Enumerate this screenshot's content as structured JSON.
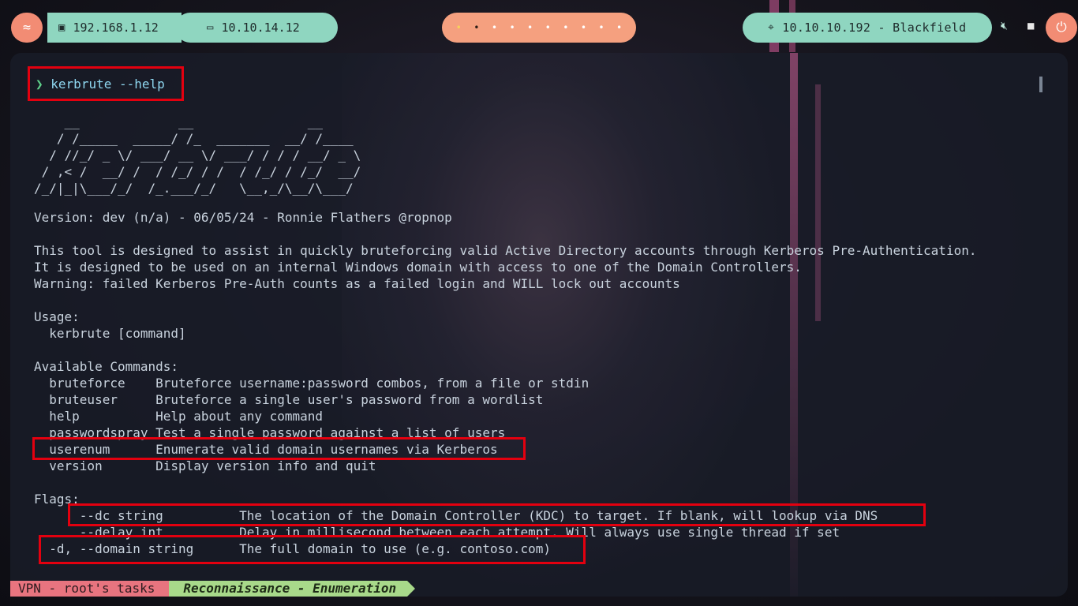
{
  "topbar": {
    "ip_local": "192.168.1.12",
    "ip_vpn": "10.10.14.12",
    "target": "10.10.10.192 - Blackfield",
    "workspaces": [
      "•",
      "•",
      "•",
      "•",
      "•",
      "•",
      "•",
      "•",
      "•",
      "•"
    ]
  },
  "terminal": {
    "prompt_arrow": "❯",
    "command": "kerbrute --help",
    "banner": [
      "    __             __               __     ",
      "   / /_____  _____/ /_  _______  __/ /____ ",
      "  / //_/ _ \\/ ___/ __ \\/ ___/ / / / __/ _ \\",
      " / ,< /  __/ /  / /_/ / /  / /_/ / /_/  __/",
      "/_/|_|\\___/_/  /_.___/_/   \\__,_/\\__/\\___/ "
    ],
    "version": "Version: dev (n/a) - 06/05/24 - Ronnie Flathers @ropnop",
    "desc1": "This tool is designed to assist in quickly bruteforcing valid Active Directory accounts through Kerberos Pre-Authentication.",
    "desc2": "It is designed to be used on an internal Windows domain with access to one of the Domain Controllers.",
    "desc3": "Warning: failed Kerberos Pre-Auth counts as a failed login and WILL lock out accounts",
    "usage_header": "Usage:",
    "usage_line": "  kerbrute [command]",
    "commands_header": "Available Commands:",
    "commands": [
      "  bruteforce    Bruteforce username:password combos, from a file or stdin",
      "  bruteuser     Bruteforce a single user's password from a wordlist",
      "  help          Help about any command",
      "  passwordspray Test a single password against a list of users",
      "  userenum      Enumerate valid domain usernames via Kerberos",
      "  version       Display version info and quit"
    ],
    "flags_header": "Flags:",
    "flags": [
      "      --dc string          The location of the Domain Controller (KDC) to target. If blank, will lookup via DNS",
      "      --delay int          Delay in millisecond between each attempt. Will always use single thread if set",
      "  -d, --domain string      The full domain to use (e.g. contoso.com)"
    ]
  },
  "statusbar": {
    "session": "VPN - root's tasks",
    "window": "Reconnaissance - Enumeration"
  }
}
